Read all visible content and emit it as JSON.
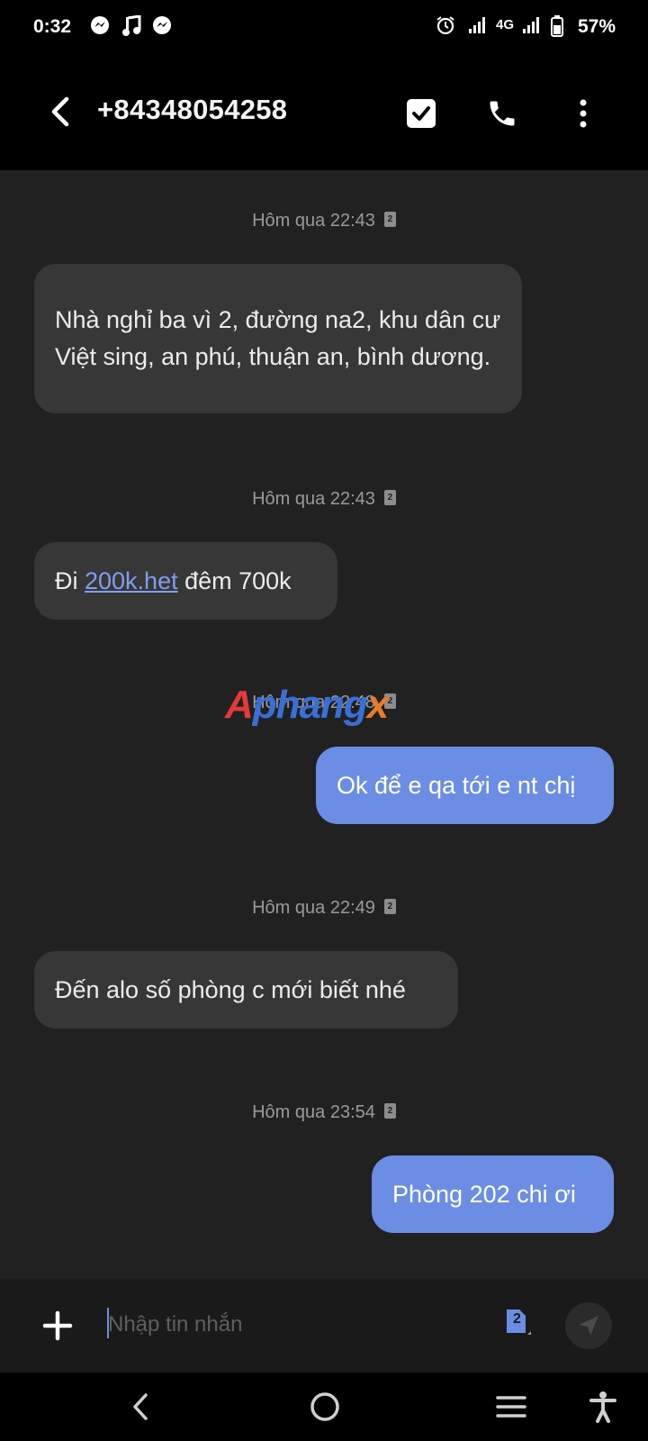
{
  "status_bar": {
    "time": "0:32",
    "network": "4G",
    "battery": "57%"
  },
  "header": {
    "title": "+84348054258"
  },
  "messages": [
    {
      "timestamp": "Hôm qua 22:43",
      "sim": "2",
      "direction": "incoming",
      "text": "Nhà nghỉ ba vì 2, đường na2,  khu dân cư Việt sing, an phú, thuận an, bình dương."
    },
    {
      "timestamp": "Hôm qua 22:43",
      "sim": "2",
      "direction": "incoming",
      "text_before": "Đi ",
      "link": "200k.het",
      "text_after": " đêm 700k"
    },
    {
      "timestamp": "Hôm qua 22:48",
      "sim": "2",
      "direction": "outgoing",
      "text": "Ok để e qa tới e nt chị"
    },
    {
      "timestamp": "Hôm qua 22:49",
      "sim": "2",
      "direction": "incoming",
      "text": "Đến alo số phòng c mới biết nhé"
    },
    {
      "timestamp": "Hôm qua 23:54",
      "sim": "2",
      "direction": "outgoing",
      "text": "Phòng 202 chi ơi"
    }
  ],
  "watermark": {
    "part1": "A",
    "part2": "phang",
    "part3": "x"
  },
  "composer": {
    "placeholder": "Nhập tin nhắn",
    "sim_label": "2"
  },
  "colors": {
    "outgoing_bubble": "#6b8ee4",
    "incoming_bubble": "#373737",
    "background": "#212121"
  },
  "icons": {
    "back": "back-arrow-icon",
    "select": "checkbox-icon",
    "call": "phone-icon",
    "more": "more-vertical-icon",
    "attach": "plus-icon",
    "send": "send-icon"
  }
}
